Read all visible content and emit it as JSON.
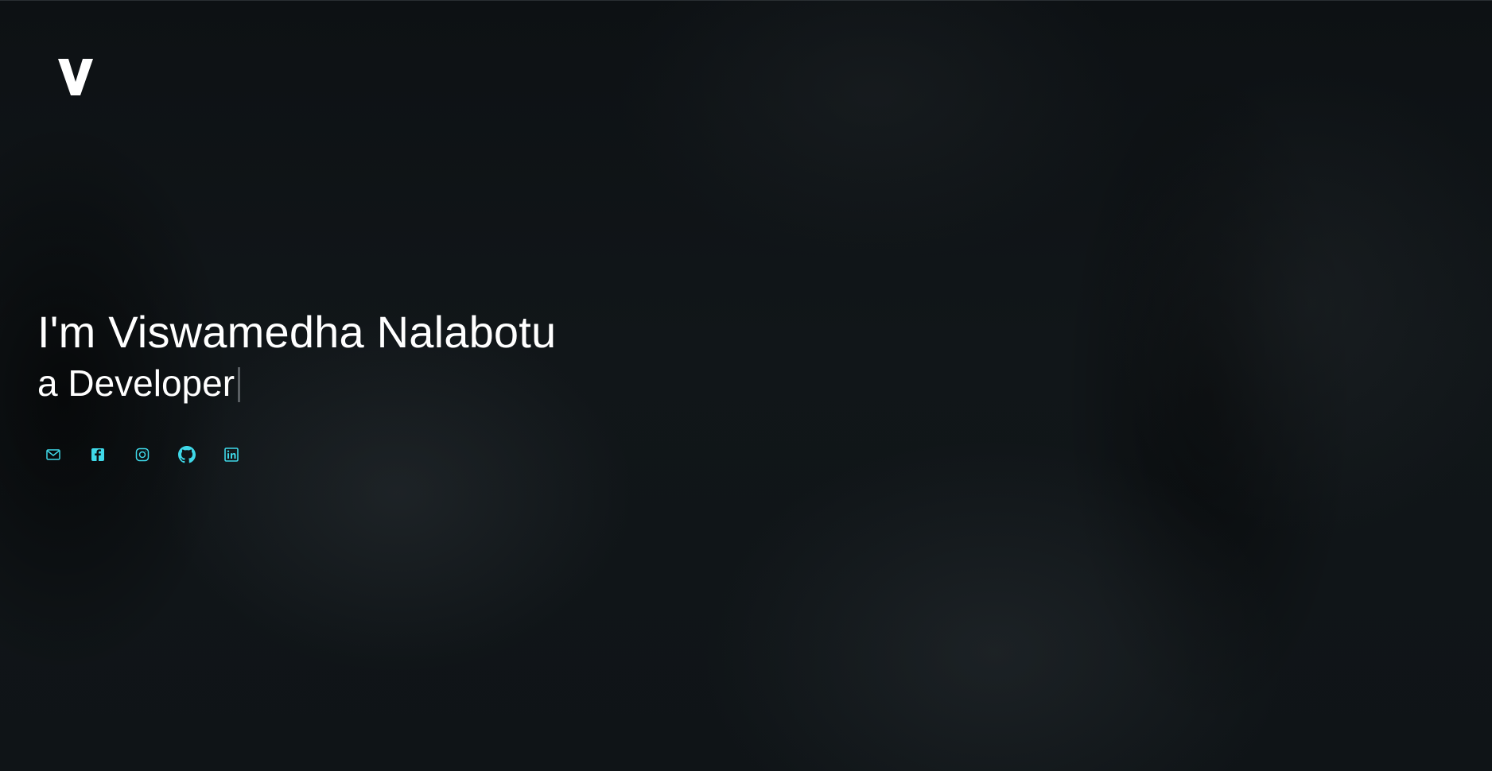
{
  "logo": {
    "text": "V",
    "icon": "v-logo-icon",
    "color": "#ffffff"
  },
  "hero": {
    "title": "I'm Viswamedha Nalabotu",
    "subtitle": "a Developer"
  },
  "social": {
    "accent_color": "#3fd8e8",
    "links": [
      {
        "icon": "mail-icon",
        "label": "Email"
      },
      {
        "icon": "facebook-icon",
        "label": "Facebook"
      },
      {
        "icon": "instagram-icon",
        "label": "Instagram"
      },
      {
        "icon": "github-icon",
        "label": "GitHub"
      },
      {
        "icon": "linkedin-icon",
        "label": "LinkedIn"
      }
    ]
  },
  "colors": {
    "background": "#0b0e10",
    "text": "#ffffff",
    "cursor": "#5a5f63"
  }
}
